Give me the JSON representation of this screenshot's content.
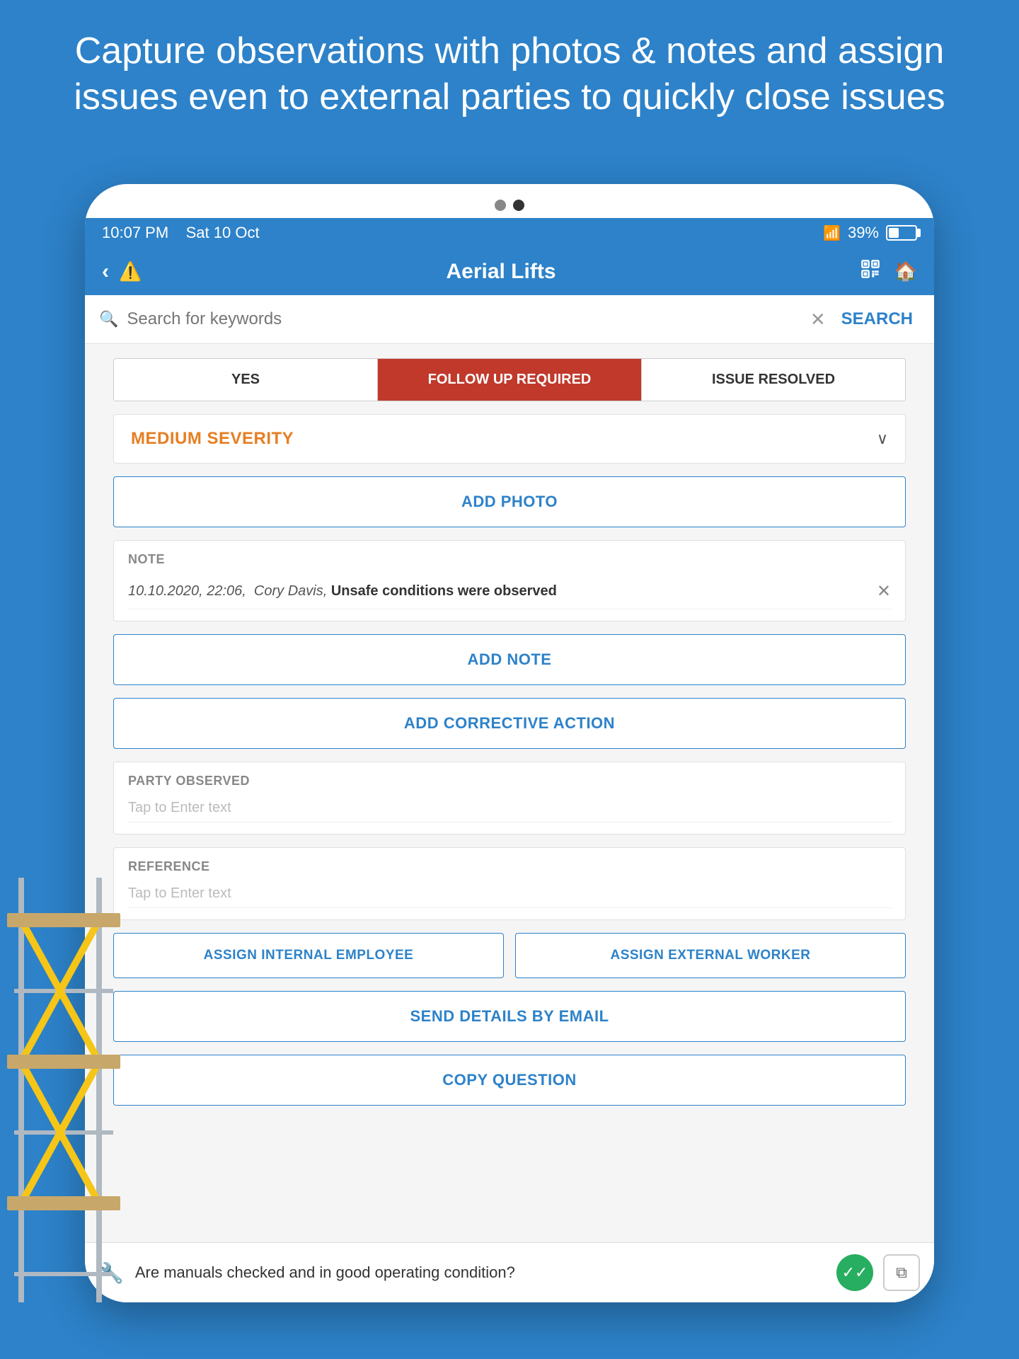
{
  "page": {
    "header_text": "Capture observations with photos & notes and assign issues even to external parties to quickly close issues"
  },
  "status_bar": {
    "time": "10:07 PM",
    "date": "Sat 10 Oct",
    "battery": "39%"
  },
  "nav": {
    "title": "Aerial Lifts"
  },
  "search": {
    "placeholder": "Search for keywords",
    "button_label": "SEARCH"
  },
  "tabs": [
    {
      "label": "YES",
      "active": false
    },
    {
      "label": "FOLLOW UP REQUIRED",
      "active": true
    },
    {
      "label": "ISSUE RESOLVED",
      "active": false
    }
  ],
  "severity": {
    "label": "MEDIUM SEVERITY"
  },
  "buttons": {
    "add_photo": "ADD PHOTO",
    "add_note": "ADD NOTE",
    "add_corrective": "ADD CORRECTIVE ACTION",
    "assign_internal": "ASSIGN INTERNAL EMPLOYEE",
    "assign_external": "ASSIGN EXTERNAL WORKER",
    "send_email": "SEND DETAILS BY EMAIL",
    "copy_question": "COPY QUESTION"
  },
  "note": {
    "label": "NOTE",
    "entry": "10.10.2020, 22:06,  Cory Davis, Unsafe conditions were observed"
  },
  "fields": {
    "party_label": "PARTY OBSERVED",
    "party_placeholder": "Tap to Enter text",
    "reference_label": "REFERENCE",
    "reference_placeholder": "Tap to Enter text"
  },
  "bottom_bar": {
    "text": "Are manuals checked and in good operating condition?"
  },
  "dots": {
    "left": "dot-gray",
    "right": "dot-dark"
  }
}
